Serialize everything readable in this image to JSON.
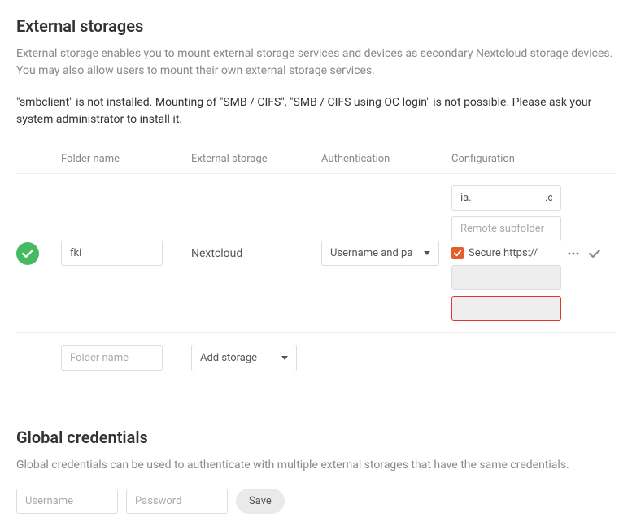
{
  "header": {
    "title": "External storages",
    "description": "External storage enables you to mount external storage services and devices as secondary Nextcloud storage devices. You may also allow users to mount their own external storage services.",
    "warning": "\"smbclient\" is not installed. Mounting of \"SMB / CIFS\", \"SMB / CIFS using OC login\" is not possible. Please ask your system administrator to install it."
  },
  "columns": {
    "folder": "Folder name",
    "storage": "External storage",
    "auth": "Authentication",
    "config": "Configuration"
  },
  "row": {
    "folder_value": "fki",
    "storage_label": "Nextcloud",
    "auth_label": "Username and pa",
    "config": {
      "host_value": "ia.                            .coop",
      "subfolder_placeholder": "Remote subfolder",
      "secure_label": "Secure https://",
      "username_value": "",
      "password_value": ""
    }
  },
  "add_row": {
    "folder_placeholder": "Folder name",
    "add_label": "Add storage"
  },
  "global": {
    "title": "Global credentials",
    "description": "Global credentials can be used to authenticate with multiple external storages that have the same credentials.",
    "username_placeholder": "Username",
    "password_placeholder": "Password",
    "save_label": "Save"
  }
}
